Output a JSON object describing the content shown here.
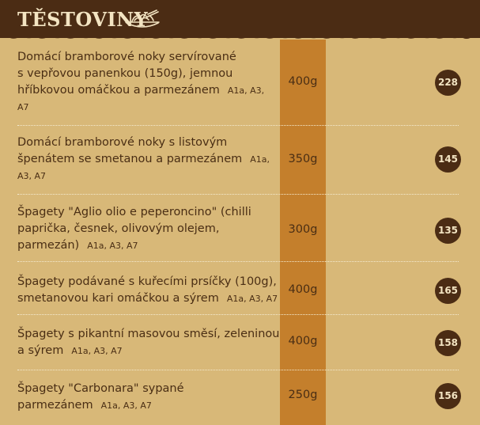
{
  "section": {
    "title": "TĚSTOVINY",
    "icon": "pasta-icon"
  },
  "colors": {
    "background": "#d8b878",
    "header": "#4b2c14",
    "weight_column": "#c47f2c",
    "price_badge": "#4b2c14"
  },
  "items": [
    {
      "lines": [
        "Domácí bramborové noky servírované",
        "s vepřovou panenkou (150g), jemnou",
        "hříbkovou omáčkou a parmezánem"
      ],
      "allergens": "A1a, A3,",
      "allergens_tail": "A7",
      "weight": "400g",
      "price": "228"
    },
    {
      "lines": [
        "Domácí bramborové noky s listovým",
        "špenátem se smetanou a parmezánem"
      ],
      "allergens": "A1a,",
      "allergens_tail": "A3, A7",
      "weight": "350g",
      "price": "145"
    },
    {
      "lines": [
        "Špagety \"Aglio olio e peperoncino\" (chilli",
        "paprička, česnek, olivovým olejem,",
        "parmezán)"
      ],
      "allergens": "A1a, A3, A7",
      "allergens_tail": "",
      "weight": "300g",
      "price": "135"
    },
    {
      "lines": [
        "Špagety podávané s kuřecími prsíčky (100g),",
        "smetanovou kari omáčkou a sýrem"
      ],
      "allergens": "A1a, A3, A7",
      "allergens_tail": "",
      "weight": "400g",
      "price": "165"
    },
    {
      "lines": [
        "Špagety s pikantní masovou směsí, zeleninou",
        "a sýrem"
      ],
      "allergens": "A1a, A3, A7",
      "allergens_tail": "",
      "weight": "400g",
      "price": "158"
    },
    {
      "lines": [
        "Špagety \"Carbonara\" sypané",
        "parmezánem"
      ],
      "allergens": "A1a, A3, A7",
      "allergens_tail": "",
      "weight": "250g",
      "price": "156"
    }
  ]
}
